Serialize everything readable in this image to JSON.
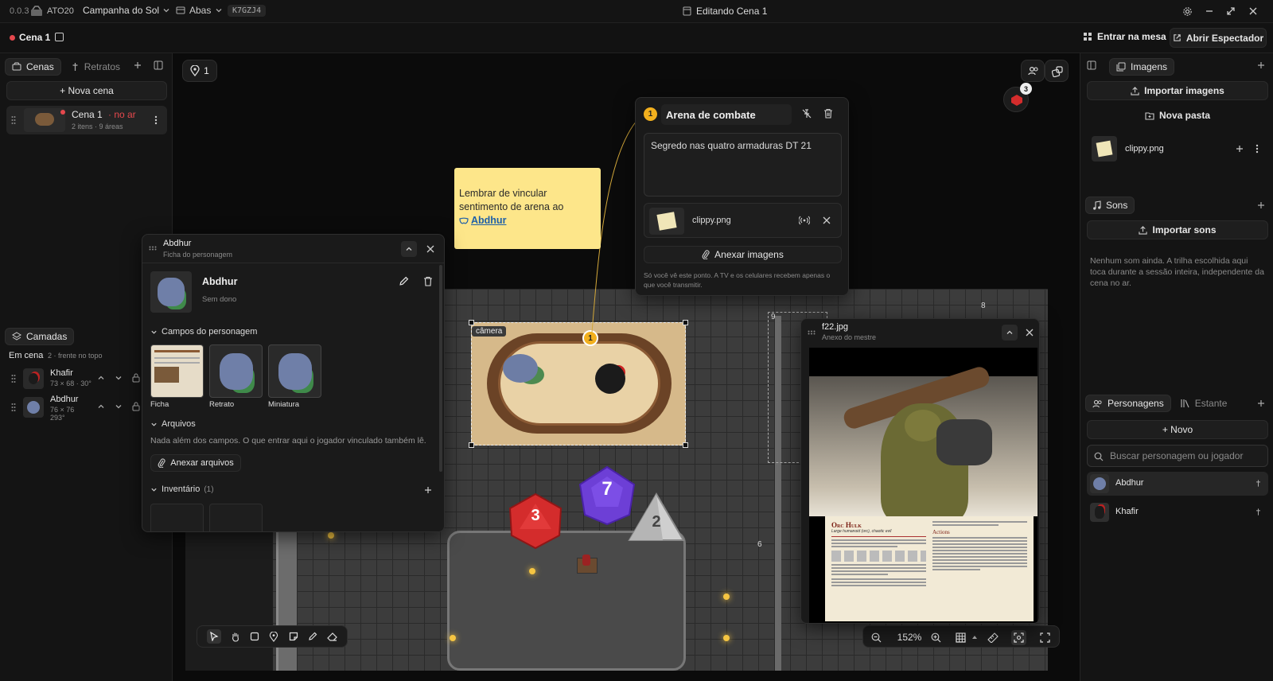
{
  "titlebar": {
    "version": "0.0.3",
    "brand": "ATO20",
    "campaign": "Campanha do Sol",
    "tabs_label": "Abas",
    "session_code": "K7GZJ4",
    "window_title": "Editando Cena 1"
  },
  "toolbar": {
    "scene_name": "Cena 1",
    "enter_table": "Entrar na mesa",
    "open_spectator": "Abrir Espectador"
  },
  "left": {
    "tabs": [
      {
        "label": "Cenas"
      },
      {
        "label": "Retratos"
      }
    ],
    "new_scene": "+ Nova cena",
    "scene": {
      "name": "Cena 1",
      "status": "· no ar",
      "meta": "2 itens · 9 áreas"
    },
    "layers_tab": "Camadas",
    "in_scene": "Em cena",
    "in_scene_meta": "2 · frente no topo",
    "layers": [
      {
        "name": "Khafir",
        "size": "73 × 68 · 30°"
      },
      {
        "name": "Abdhur",
        "size": "76 × 76",
        "rotation": "293°"
      }
    ]
  },
  "canvas": {
    "pin_count": "1",
    "dice_badge": "3",
    "sticky_note": {
      "text": "Lembrar de vincular sentimento de arena ao",
      "link": "Abdhur"
    },
    "camera_label": "câmera",
    "area_pin": "1",
    "area_numbers": [
      "9",
      "8",
      "6"
    ],
    "dice": [
      {
        "value": "7"
      },
      {
        "value": "3"
      },
      {
        "value": "2"
      }
    ],
    "zoom": "152%"
  },
  "area_popup": {
    "number": "1",
    "title": "Arena de combate",
    "note": "Segredo nas quatro armaduras DT 21",
    "attachment": "clippy.png",
    "attach_images": "Anexar imagens",
    "hint": "Só você vê este ponto. A TV e os celulares recebem apenas o que você transmitir."
  },
  "char_sheet": {
    "title": "Abdhur",
    "subtitle": "Ficha do personagem",
    "name": "Abdhur",
    "owner": "Sem dono",
    "fields_header": "Campos do personagem",
    "fields": [
      {
        "label": "Ficha"
      },
      {
        "label": "Retrato"
      },
      {
        "label": "Miniatura"
      }
    ],
    "files_header": "Arquivos",
    "files_text": "Nada além dos campos. O que entrar aqui o jogador vinculado também lê.",
    "attach_files": "Anexar arquivos",
    "inventory_header": "Inventário",
    "inventory_count": "(1)"
  },
  "image_viewer": {
    "title": "f22.jpg",
    "subtitle": "Anexo do mestre",
    "stat_title": "Orc Hulk",
    "stat_sub": "Large humanoid (orc), chaotic evil",
    "stat_actions": "Actions"
  },
  "right": {
    "images_tab": "Imagens",
    "import_images": "Importar imagens",
    "new_folder": "Nova pasta",
    "image_item": "clippy.png",
    "sounds_tab": "Sons",
    "import_sounds": "Importar sons",
    "sounds_empty": "Nenhum som ainda. A trilha escolhida aqui toca durante a sessão inteira, independente da cena no ar.",
    "chars_tab": "Personagens",
    "shelf_tab": "Estante",
    "new_char": "+ Novo",
    "search_placeholder": "Buscar personagem ou jogador",
    "chars": [
      {
        "name": "Abdhur"
      },
      {
        "name": "Khafir"
      }
    ]
  },
  "colors": {
    "accent": "#f2b01e",
    "live": "#e5484d",
    "sticky": "#fde68a",
    "dice_purple": "#6d3fd6",
    "dice_red": "#d42c2c"
  }
}
